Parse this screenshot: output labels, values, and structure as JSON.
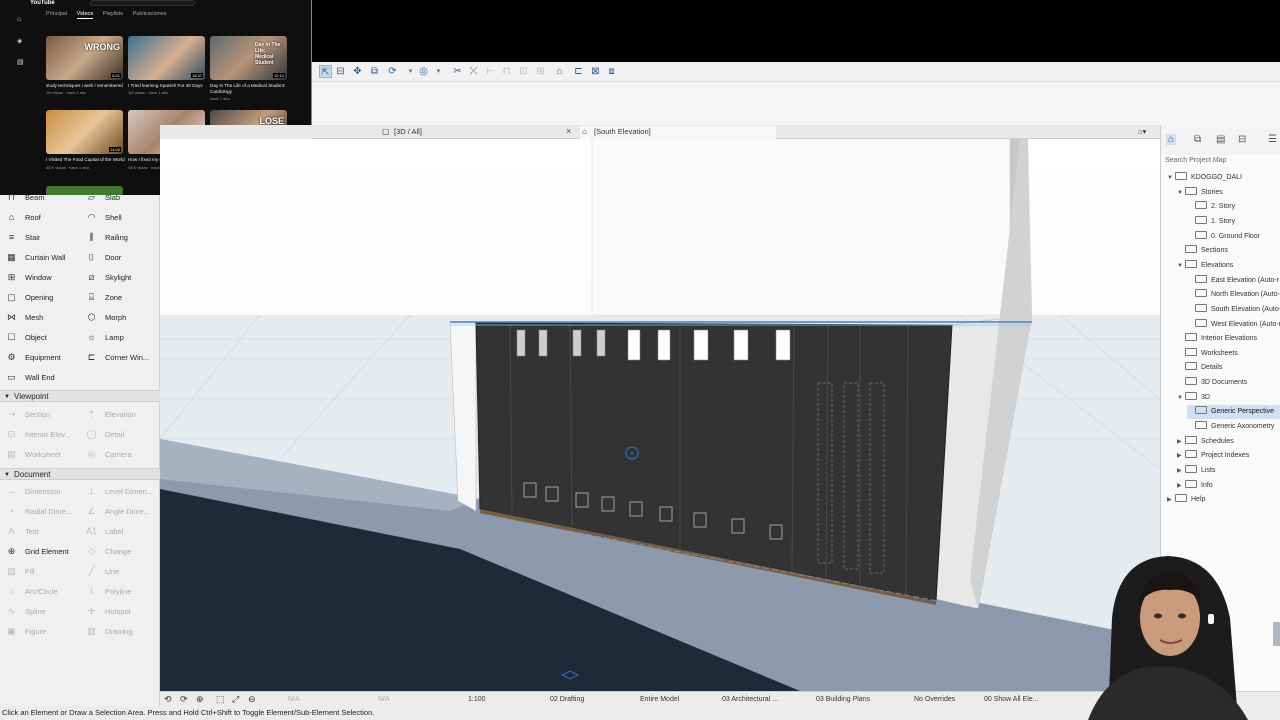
{
  "youtube": {
    "logo": "YouTube",
    "sidebar_icons": [
      "home-icon",
      "shorts-icon",
      "subscriptions-icon"
    ],
    "sidebar_labels": [
      "Principal",
      "Shorts",
      "Suscripciones"
    ],
    "tabs": [
      "Principal",
      "Videos",
      "Playlists",
      "Publicaciones"
    ],
    "videos": [
      {
        "title": "study techniques i wish i remembered",
        "meta": "1M vistas · hace 1 año",
        "thumb_text": "WRONG",
        "duration": "6:21"
      },
      {
        "title": "I Tried learning Spanish For 30 Days",
        "meta": "1M vistas · hace 1 año",
        "thumb_text": "",
        "duration": "18:37"
      },
      {
        "title": "Day in The Life of a Medical Student: Cardiology",
        "meta": "hace 1 año",
        "thumb_text": "Day in The Life: Medical Student",
        "duration": "12:14"
      },
      {
        "title": "I Visited The Food Capital of the World",
        "meta": "45 K vistas · hace 1 año",
        "thumb_text": "",
        "duration": "14:02"
      },
      {
        "title": "How I fixed my sleep in one week",
        "meta": "45 K vistas · hace 1 año",
        "thumb_text": "",
        "duration": "10:06"
      },
      {
        "title": "The Highest Yield Study Technique. There is",
        "meta": "hace 1 año",
        "thumb_text": "LOSE",
        "duration": "11:23"
      }
    ]
  },
  "toolbox": {
    "design_tools": [
      {
        "label": "Beam",
        "icon": "beam-icon"
      },
      {
        "label": "Slab",
        "icon": "slab-icon"
      },
      {
        "label": "Roof",
        "icon": "roof-icon"
      },
      {
        "label": "Shell",
        "icon": "shell-icon"
      },
      {
        "label": "Stair",
        "icon": "stair-icon"
      },
      {
        "label": "Railing",
        "icon": "railing-icon"
      },
      {
        "label": "Curtain Wall",
        "icon": "curtain-wall-icon"
      },
      {
        "label": "Door",
        "icon": "door-icon"
      },
      {
        "label": "Window",
        "icon": "window-icon"
      },
      {
        "label": "Skylight",
        "icon": "skylight-icon"
      },
      {
        "label": "Opening",
        "icon": "opening-icon"
      },
      {
        "label": "Zone",
        "icon": "zone-icon"
      },
      {
        "label": "Mesh",
        "icon": "mesh-icon"
      },
      {
        "label": "Morph",
        "icon": "morph-icon"
      },
      {
        "label": "Object",
        "icon": "object-icon"
      },
      {
        "label": "Lamp",
        "icon": "lamp-icon"
      },
      {
        "label": "Equipment",
        "icon": "equipment-icon"
      },
      {
        "label": "Corner Win...",
        "icon": "corner-window-icon"
      },
      {
        "label": "Wall End",
        "icon": "wall-end-icon"
      }
    ],
    "viewpoint_label": "Viewpoint",
    "viewpoint_tools": [
      {
        "label": "Section",
        "icon": "section-icon"
      },
      {
        "label": "Elevation",
        "icon": "elevation-icon"
      },
      {
        "label": "Interior Elev...",
        "icon": "interior-elevation-icon"
      },
      {
        "label": "Detail",
        "icon": "detail-icon"
      },
      {
        "label": "Worksheet",
        "icon": "worksheet-icon"
      },
      {
        "label": "Camera",
        "icon": "camera-icon"
      }
    ],
    "document_label": "Document",
    "document_tools": [
      {
        "label": "Dimension",
        "icon": "dimension-icon",
        "enabled": false
      },
      {
        "label": "Level Dimen...",
        "icon": "level-dimension-icon",
        "enabled": false
      },
      {
        "label": "Radial Dime...",
        "icon": "radial-dimension-icon",
        "enabled": false
      },
      {
        "label": "Angle Dime...",
        "icon": "angle-dimension-icon",
        "enabled": false
      },
      {
        "label": "Text",
        "icon": "text-icon",
        "enabled": false
      },
      {
        "label": "Label",
        "icon": "label-icon",
        "enabled": false
      },
      {
        "label": "Grid Element",
        "icon": "grid-element-icon",
        "enabled": true
      },
      {
        "label": "Change",
        "icon": "change-icon",
        "enabled": false
      },
      {
        "label": "Fill",
        "icon": "fill-icon",
        "enabled": false
      },
      {
        "label": "Line",
        "icon": "line-icon",
        "enabled": false
      },
      {
        "label": "Arc/Circle",
        "icon": "arc-circle-icon",
        "enabled": false
      },
      {
        "label": "Polyline",
        "icon": "polyline-icon",
        "enabled": false
      },
      {
        "label": "Spline",
        "icon": "spline-icon",
        "enabled": false
      },
      {
        "label": "Hotspot",
        "icon": "hotspot-icon",
        "enabled": false
      },
      {
        "label": "Figure",
        "icon": "figure-icon",
        "enabled": false
      },
      {
        "label": "Drawing",
        "icon": "drawing-icon",
        "enabled": false
      }
    ]
  },
  "tabs": [
    {
      "label": "[3D / All]",
      "icon": "3d-view-icon"
    },
    {
      "label": "[South Elevation]",
      "icon": "elevation-view-icon"
    }
  ],
  "navigator": {
    "search_placeholder": "Search Project Map",
    "items": [
      {
        "label": "KDOGGO_DALI",
        "level": 0,
        "expand": "▼"
      },
      {
        "label": "Stories",
        "level": 1,
        "expand": "▼"
      },
      {
        "label": "2. Story",
        "level": 2,
        "expand": ""
      },
      {
        "label": "1. Story",
        "level": 2,
        "expand": ""
      },
      {
        "label": "0. Ground Floor",
        "level": 2,
        "expand": ""
      },
      {
        "label": "Sections",
        "level": 1,
        "expand": ""
      },
      {
        "label": "Elevations",
        "level": 1,
        "expand": "▼"
      },
      {
        "label": "East Elevation (Auto-r",
        "level": 2,
        "expand": ""
      },
      {
        "label": "North Elevation (Auto-",
        "level": 2,
        "expand": ""
      },
      {
        "label": "South Elevation (Auto-r",
        "level": 2,
        "expand": ""
      },
      {
        "label": "West Elevation (Auto-re",
        "level": 2,
        "expand": ""
      },
      {
        "label": "Interior Elevations",
        "level": 1,
        "expand": ""
      },
      {
        "label": "Worksheets",
        "level": 1,
        "expand": ""
      },
      {
        "label": "Details",
        "level": 1,
        "expand": ""
      },
      {
        "label": "3D Documents",
        "level": 1,
        "expand": ""
      },
      {
        "label": "3D",
        "level": 1,
        "expand": "▼"
      },
      {
        "label": "Generic Perspective",
        "level": 2,
        "expand": "",
        "selected": true
      },
      {
        "label": "Generic Axonometry",
        "level": 2,
        "expand": ""
      },
      {
        "label": "Schedules",
        "level": 1,
        "expand": "▶"
      },
      {
        "label": "Project Indexes",
        "level": 1,
        "expand": "▶"
      },
      {
        "label": "Lists",
        "level": 1,
        "expand": "▶"
      },
      {
        "label": "Info",
        "level": 1,
        "expand": "▶"
      },
      {
        "label": "Help",
        "level": 0,
        "expand": "▶"
      }
    ]
  },
  "statusbar": {
    "items": [
      "N/A",
      "N/A",
      "1:100",
      "02 Drafting",
      "Entire Model",
      "03 Architectural ...",
      "03 Building Plans",
      "No Overrides",
      "00 Show All Ele..."
    ]
  },
  "hint": "Click an Element or Draw a Selection Area. Press and Hold Ctrl+Shift to Toggle Element/Sub-Element Selection.",
  "colors": {
    "accent": "#2a5d8f",
    "selection": "#cfe0f2",
    "wall_dark": "#2f2f2f"
  }
}
